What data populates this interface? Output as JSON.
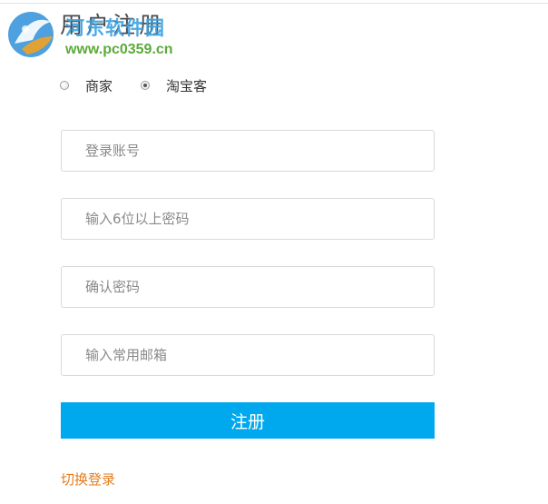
{
  "page": {
    "title": "用户注册"
  },
  "watermark": {
    "name": "河东软件园",
    "url": "www.pc0359.cn"
  },
  "role": {
    "options": [
      {
        "label": "商家",
        "checked": false
      },
      {
        "label": "淘宝客",
        "checked": true
      }
    ]
  },
  "form": {
    "account_placeholder": "登录账号",
    "password_placeholder": "输入6位以上密码",
    "confirm_placeholder": "确认密码",
    "email_placeholder": "输入常用邮箱",
    "submit_label": "注册"
  },
  "footer": {
    "switch_login_label": "切换登录"
  },
  "colors": {
    "accent": "#00a9ee",
    "link": "#e57d1d",
    "field_border": "#d9d9d9",
    "watermark_blue": "#3aa0e0",
    "watermark_green": "#5bab3a"
  }
}
